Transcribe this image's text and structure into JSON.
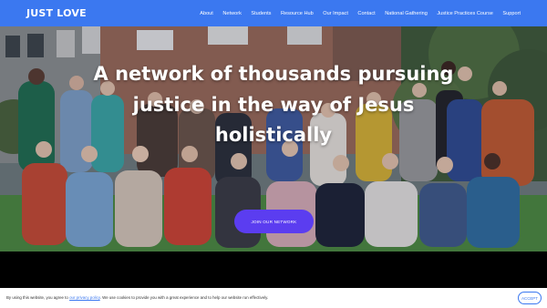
{
  "header": {
    "logo": "JUST LOVE",
    "nav": [
      "About",
      "Network",
      "Students",
      "Resource Hub",
      "Our Impact",
      "Contact",
      "National Gathering",
      "Justice Practices Course",
      "Support"
    ]
  },
  "hero": {
    "headline_lines": [
      "A network of thousands pursuing",
      "justice in the way of Jesus",
      "holistically"
    ],
    "cta_label": "JOIN OUR NETWORK",
    "cta_color": "#5b3df0"
  },
  "cookie": {
    "text_before": "By using this website, you agree to",
    "link_text": "our privacy policy",
    "text_after": ". We use cookies to provide you with a great experience and to help our website run effectively.",
    "accept_label": "ACCEPT"
  },
  "colors": {
    "header_bg": "#3b78f0",
    "accent": "#3b78f0"
  }
}
